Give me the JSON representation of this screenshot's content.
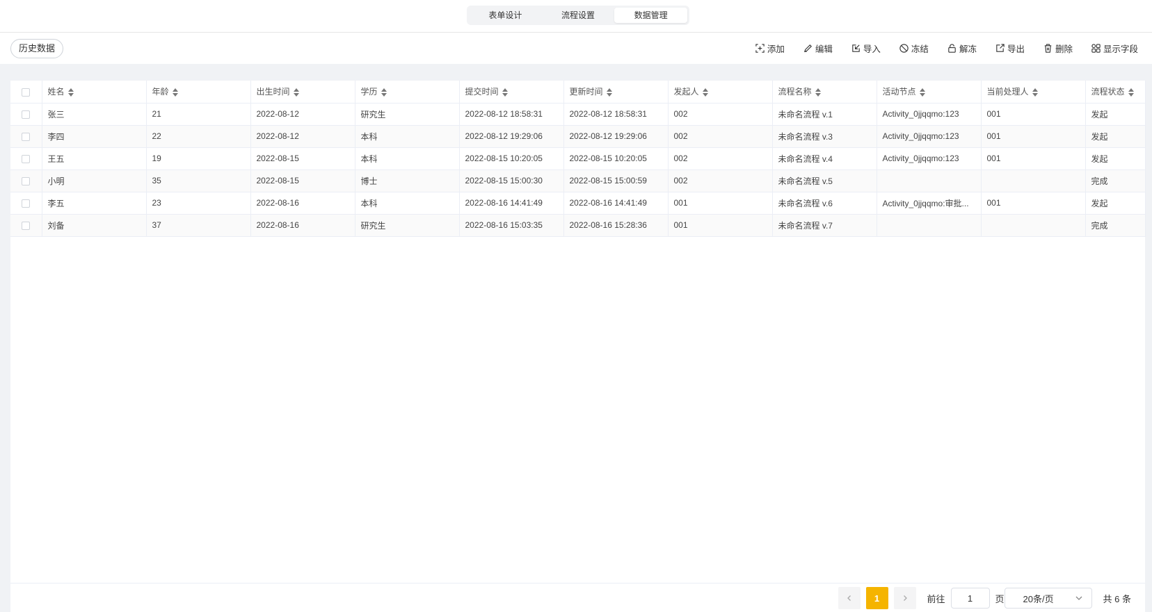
{
  "tabs": [
    {
      "label": "表单设计",
      "active": false
    },
    {
      "label": "流程设置",
      "active": false
    },
    {
      "label": "数据管理",
      "active": true
    }
  ],
  "toolbar": {
    "history_label": "历史数据",
    "actions": [
      {
        "label": "添加",
        "icon": "add-icon"
      },
      {
        "label": "编辑",
        "icon": "edit-icon"
      },
      {
        "label": "导入",
        "icon": "import-icon"
      },
      {
        "label": "冻结",
        "icon": "freeze-icon"
      },
      {
        "label": "解冻",
        "icon": "unfreeze-icon"
      },
      {
        "label": "导出",
        "icon": "export-icon"
      },
      {
        "label": "删除",
        "icon": "delete-icon"
      },
      {
        "label": "显示字段",
        "icon": "fields-icon"
      }
    ]
  },
  "table": {
    "columns": [
      "姓名",
      "年龄",
      "出生时间",
      "学历",
      "提交时间",
      "更新时间",
      "发起人",
      "流程名称",
      "活动节点",
      "当前处理人",
      "流程状态"
    ],
    "rows": [
      [
        "张三",
        "21",
        "2022-08-12",
        "研究生",
        "2022-08-12 18:58:31",
        "2022-08-12 18:58:31",
        "002",
        "未命名流程 v.1",
        "Activity_0jjqqmo:123",
        "001",
        "发起"
      ],
      [
        "李四",
        "22",
        "2022-08-12",
        "本科",
        "2022-08-12 19:29:06",
        "2022-08-12 19:29:06",
        "002",
        "未命名流程 v.3",
        "Activity_0jjqqmo:123",
        "001",
        "发起"
      ],
      [
        "王五",
        "19",
        "2022-08-15",
        "本科",
        "2022-08-15 10:20:05",
        "2022-08-15 10:20:05",
        "002",
        "未命名流程 v.4",
        "Activity_0jjqqmo:123",
        "001",
        "发起"
      ],
      [
        "小明",
        "35",
        "2022-08-15",
        "博士",
        "2022-08-15 15:00:30",
        "2022-08-15 15:00:59",
        "002",
        "未命名流程 v.5",
        "",
        "",
        "完成"
      ],
      [
        "李五",
        "23",
        "2022-08-16",
        "本科",
        "2022-08-16 14:41:49",
        "2022-08-16 14:41:49",
        "001",
        "未命名流程 v.6",
        "Activity_0jjqqmo:审批...",
        "001",
        "发起"
      ],
      [
        "刘备",
        "37",
        "2022-08-16",
        "研究生",
        "2022-08-16 15:03:35",
        "2022-08-16 15:28:36",
        "001",
        "未命名流程 v.7",
        "",
        "",
        "完成"
      ]
    ]
  },
  "pagination": {
    "prev_icon": "chevron-left-icon",
    "next_icon": "chevron-right-icon",
    "current_page": "1",
    "goto_label": "前往",
    "goto_value": "1",
    "page_unit": "页",
    "page_size": "20条/页",
    "total": "共 6 条"
  }
}
